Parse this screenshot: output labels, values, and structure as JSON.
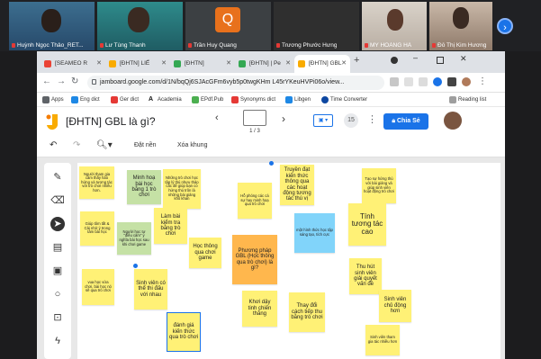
{
  "meeting": {
    "participants": [
      {
        "name": "Huỳnh Ngọc Thảo_RET..."
      },
      {
        "name": "Lư Tùng Thanh"
      },
      {
        "name": "Trần Huy Quang",
        "initial": "Q"
      },
      {
        "name": "Trương Phước Hưng"
      },
      {
        "name": "MY HOÀNG HÀ"
      },
      {
        "name": "Đỗ Thị Kim Hương"
      }
    ]
  },
  "browser": {
    "tabs": [
      {
        "label": "[SEAMEO R"
      },
      {
        "label": "[ĐHTN] LIẾ"
      },
      {
        "label": "[ĐHTN]"
      },
      {
        "label": "[ĐHTN] | Pe"
      },
      {
        "label": "[ĐHTN] GBL"
      }
    ],
    "url": "jamboard.google.com/d/1N/bqQj6SJAcGFm6vyb5p0twgKHm L45rYKeuHVPi06o/view...",
    "bookmarks": [
      "Apps",
      "Eng dict",
      "Ger dict",
      "Academia",
      "EPdf.Pub",
      "Synonyms dict",
      "Libgen",
      "Time Converter"
    ],
    "reading_list": "Reading list"
  },
  "jamboard": {
    "title": "[ĐHTN] GBL là gì?",
    "frame_page": "1 / 3",
    "count": "15",
    "share_label": "Chia Sẻ",
    "toolbar": {
      "set_bg": "Đặt nền",
      "clear": "Xóa khung"
    },
    "notes": [
      "Người tham gia cảm thấy hào hứng và tương tác với trò chơi nhiều hơn.",
      "Minh hoạ bài học bằng 1 trò chơi",
      "Những trò chơi học tập lý thú nhưu thảo cấc để giúp bạn có hứng thú trôn là những bài giảng khô khan",
      "Truyền đạt kiến thức thông qua các hoạt động tương tác thú vị",
      "Tạo sự hứng thú với bài giảng và giúp sinh viên hoạt động trò chơi",
      "Hỗ phóng các cá sự hay minh hoạ qua trò chơi",
      "Giúp tôm tắt & Cải nhớ ý trong tâm bài học",
      "Người học tự \"điều cảm\" ý nghĩa bài học sau khi chơi game",
      "Làm bài kiểm tra bằng trò chơi",
      "Học thông qua chơi game",
      "một hình thức học tập sáng tạo, tích cực",
      "Tính tương tác cao",
      "Phương pháp GBL (Học thông qua trò chơi) là gì?",
      "vua học vừa chơi, bài học nó sẽ qua trò chơi",
      "Sinh viên có thể thi đấu với nhau",
      "Khơi dậy tinh chiến thắng",
      "Thay đổi cách tiếp thu bằng trò chơi",
      "Thu hút sinh viên giải quyết vấn đề",
      "Sinh viên chủ động hơn",
      "đánh giá kiến thức qua trò chơi",
      "Sinh viên tham gia tác nhiều hơn"
    ]
  }
}
